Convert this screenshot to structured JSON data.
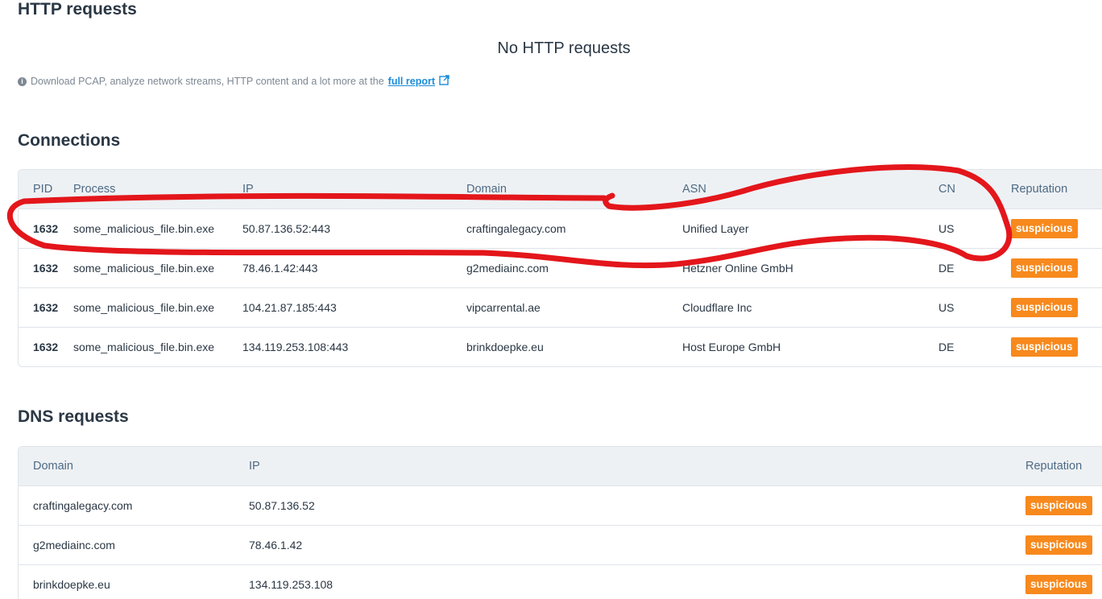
{
  "http": {
    "title": "HTTP requests",
    "empty_message": "No HTTP requests",
    "note_text": "Download PCAP, analyze network streams, HTTP content and a lot more at the",
    "note_link": "full report",
    "info_icon": "info-circle-icon",
    "external_icon": "external-link-icon"
  },
  "connections": {
    "title": "Connections",
    "headers": {
      "pid": "PID",
      "process": "Process",
      "ip": "IP",
      "domain": "Domain",
      "asn": "ASN",
      "cn": "CN",
      "reputation": "Reputation"
    },
    "rows": [
      {
        "pid": "1632",
        "process": "some_malicious_file.bin.exe",
        "ip": "50.87.136.52:443",
        "domain": "craftingalegacy.com",
        "asn": "Unified Layer",
        "cn": "US",
        "reputation": "suspicious"
      },
      {
        "pid": "1632",
        "process": "some_malicious_file.bin.exe",
        "ip": "78.46.1.42:443",
        "domain": "g2mediainc.com",
        "asn": "Hetzner Online GmbH",
        "cn": "DE",
        "reputation": "suspicious"
      },
      {
        "pid": "1632",
        "process": "some_malicious_file.bin.exe",
        "ip": "104.21.87.185:443",
        "domain": "vipcarrental.ae",
        "asn": "Cloudflare Inc",
        "cn": "US",
        "reputation": "suspicious"
      },
      {
        "pid": "1632",
        "process": "some_malicious_file.bin.exe",
        "ip": "134.119.253.108:443",
        "domain": "brinkdoepke.eu",
        "asn": "Host Europe GmbH",
        "cn": "DE",
        "reputation": "suspicious"
      }
    ]
  },
  "dns": {
    "title": "DNS requests",
    "headers": {
      "domain": "Domain",
      "ip": "IP",
      "reputation": "Reputation"
    },
    "rows": [
      {
        "domain": "craftingalegacy.com",
        "ip": "50.87.136.52",
        "reputation": "suspicious"
      },
      {
        "domain": "g2mediainc.com",
        "ip": "78.46.1.42",
        "reputation": "suspicious"
      },
      {
        "domain": "brinkdoepke.eu",
        "ip": "134.119.253.108",
        "reputation": "suspicious"
      }
    ]
  },
  "colors": {
    "badge": "#f7891d",
    "annotation": "#e3161b",
    "link": "#1a8cd8",
    "header_bg": "#eef1f4"
  }
}
